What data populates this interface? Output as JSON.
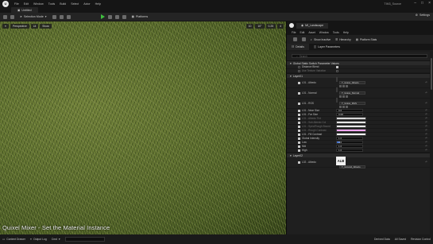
{
  "editor": {
    "menu": [
      "File",
      "Edit",
      "Window",
      "Tools",
      "Build",
      "Select",
      "Actor",
      "Help"
    ],
    "level_tab": "Untitled",
    "toolbar": {
      "mode": "Selection Mode",
      "platforms": "Platforms",
      "settings": "Settings"
    },
    "window_title_right": "TIM3_Source"
  },
  "viewport": {
    "chips": [
      "Perspective",
      "Lit",
      "Show"
    ],
    "right_chips": [
      "10",
      "10°",
      "0.25",
      "4"
    ],
    "caption": "Quixel Mixer - Set the Material Instance"
  },
  "statusbar": {
    "items": [
      "Content Drawer",
      "Output Log",
      "Cmd"
    ],
    "right": [
      "Derived Data",
      "All Saved",
      "Revision Control"
    ]
  },
  "material_instance": {
    "tab_title": "MI_Landscape",
    "menu": [
      "File",
      "Edit",
      "Asset",
      "Window",
      "Tools",
      "Help"
    ],
    "toolbar": [
      "Show Inactive",
      "Hierarchy",
      "Platform Stats"
    ],
    "panels": [
      "Details",
      "Layer Parameters"
    ],
    "search_placeholder": "Search",
    "sections": {
      "global": "Global Static Switch Parameter Values",
      "layer01": "Layer01",
      "layer02": "Layer02"
    },
    "global_rows": [
      {
        "label": "Distance Blend",
        "checked": true,
        "dim": false
      },
      {
        "label": "Use Texture Variation",
        "checked": false,
        "dim": true
      }
    ],
    "layer01_rows": [
      {
        "kind": "tex",
        "label": "L01 - Albedo",
        "thumb": "#4c5a22",
        "asset": "T_Grass_Albedo"
      },
      {
        "kind": "tex",
        "label": "L01 - Normal",
        "thumb": "#8b8fef",
        "asset": "T_Grass_Normal"
      },
      {
        "kind": "tex",
        "label": "L01 - RGS",
        "thumb": "#d68aa0",
        "asset": "T_Grass_RGS"
      },
      {
        "kind": "num",
        "label": "L01 - Near Size",
        "value": "0.6"
      },
      {
        "kind": "num",
        "label": "L01 - Far Size",
        "value": "0.08"
      },
      {
        "kind": "color",
        "label": "L01 - Albedo Tint",
        "color": "#d6d6d6",
        "dim": true
      },
      {
        "kind": "color",
        "label": "L01 - Sub Albedo Col",
        "color": "#e4e4e4",
        "dim": true
      },
      {
        "kind": "color",
        "label": "L01 - Spec/Rough Bound",
        "color": "#e9e9e9",
        "dim": true
      },
      {
        "kind": "color",
        "label": "L01 - Rough Contrast",
        "color": "#f0a6f0",
        "dim": true
      },
      {
        "kind": "color",
        "label": "L01 - Fill Contrast",
        "color": "#f7f7f7",
        "dim": false
      },
      {
        "kind": "num",
        "label": "Global Intensity",
        "value": "1.0"
      },
      {
        "kind": "bar",
        "label": "Low",
        "value": "0.0",
        "fill": 0.12
      },
      {
        "kind": "num",
        "label": "Mid",
        "value": "1.0"
      },
      {
        "kind": "num",
        "label": "High",
        "value": "1.0"
      }
    ],
    "layer02_rows": [
      {
        "kind": "alb",
        "label": "L02 - Albedo",
        "thumb_text": "ALB",
        "asset": "T_Ground_Albedo"
      }
    ],
    "status": [
      "Content Drawer",
      "Output Log",
      "Cmd"
    ]
  },
  "colors": {
    "accent_play": "#3fbf3f",
    "selection_blue": "#3f6fd0"
  }
}
